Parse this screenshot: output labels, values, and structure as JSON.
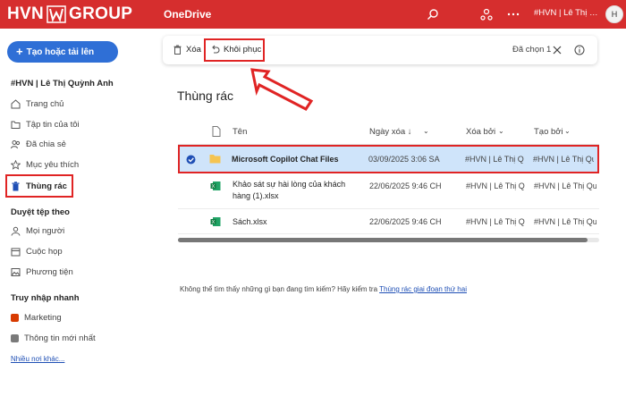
{
  "header": {
    "brand_left": "HVN",
    "brand_right": "GROUP",
    "app_name": "OneDrive",
    "user_short": "#HVN | Lê Thị Quỳ...",
    "avatar_initial": "H",
    "accent": "#d62e2e"
  },
  "sidebar": {
    "new_button": "Tạo hoặc tải lên",
    "account": "#HVN | Lê Thị Quỳnh Anh",
    "items": [
      {
        "label": "Trang chủ",
        "icon": "home-icon"
      },
      {
        "label": "Tập tin của tôi",
        "icon": "folder-icon"
      },
      {
        "label": "Đã chia sẻ",
        "icon": "people-icon"
      },
      {
        "label": "Mục yêu thích",
        "icon": "star-icon"
      },
      {
        "label": "Thùng rác",
        "icon": "trash-icon"
      }
    ],
    "browse_header": "Duyệt tệp theo",
    "browse_items": [
      {
        "label": "Mọi người",
        "icon": "person-icon"
      },
      {
        "label": "Cuộc họp",
        "icon": "calendar-icon"
      },
      {
        "label": "Phương tiện",
        "icon": "image-icon"
      }
    ],
    "quick_header": "Truy nhập nhanh",
    "quick_items": [
      {
        "label": "Marketing",
        "color": "#d83b01"
      },
      {
        "label": "Thông tin mới nhất",
        "color": "#7a7a7a"
      }
    ],
    "more_link": "Nhiều nơi khác..."
  },
  "commandbar": {
    "delete_label": "Xóa",
    "restore_label": "Khôi phục",
    "selected_label": "Đã chọn 1"
  },
  "main": {
    "title": "Thùng rác",
    "columns": {
      "name": "Tên",
      "deleted_date": "Ngày xóa ↓",
      "deleted_by": "Xóa bởi",
      "created_by": "Tạo bởi"
    },
    "rows": [
      {
        "name": "Microsoft Copilot Chat Files",
        "date": "03/09/2025 3:06 SA",
        "deleted_by": "#HVN | Lê Thị Qu",
        "created_by": "#HVN | Lê Thị Qu",
        "type": "folder",
        "selected": true
      },
      {
        "name": "Khảo sát sự hài lòng của khách",
        "name2": "hàng (1).xlsx",
        "date": "22/06/2025 9:46 CH",
        "deleted_by": "#HVN | Lê Thị Qu",
        "created_by": "#HVN | Lê Thị Qu",
        "type": "excel",
        "selected": false
      },
      {
        "name": "Sách.xlsx",
        "date": "22/06/2025 9:46 CH",
        "deleted_by": "#HVN | Lê Thị Qu",
        "created_by": "#HVN | Lê Thị Qu",
        "type": "excel",
        "selected": false
      }
    ],
    "footer_text": "Không thể tìm thấy những gì bạn đang tìm kiếm? Hãy kiểm tra",
    "footer_link": "Thùng rác giai đoạn thứ hai"
  }
}
